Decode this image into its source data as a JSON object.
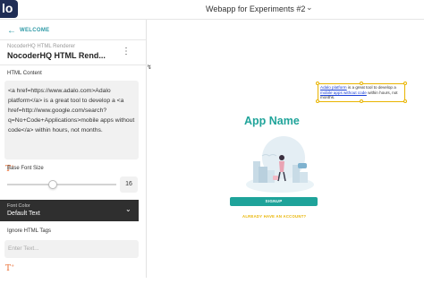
{
  "app": {
    "logo_text": "lo",
    "name": "Webapp for Experiments #2"
  },
  "panel": {
    "back_label": "WELCOME",
    "component_type": "NocoderHQ HTML Renderer",
    "component_name": "NocoderHQ HTML Rend...",
    "html_content_label": "HTML Content",
    "html_content_value": "<a href=https://www.adalo.com>Adalo platform</a> is a great tool to develop a <a href=http://www.google.com/search?q=No+Code+Applications>mobile apps without code</a> within hours, not months.",
    "base_font_size_label": "Base Font Size",
    "base_font_size_value": "16",
    "base_font_size_level": 0.42,
    "font_color_label": "Font Color",
    "font_color_value": "Default Text",
    "ignore_tags_label": "Ignore HTML Tags",
    "ignore_tags_placeholder": "Enter Text..."
  },
  "preview": {
    "link1": "Adalo platform",
    "text1": " is a great tool to develop a ",
    "link2": "mobile apps without code",
    "text2": " within hours, not months.",
    "title": "App Name",
    "signup_label": "SIGNUP",
    "login_label": "ALREADY HAVE AN ACCOUNT?"
  },
  "colors": {
    "accent": "#2e99a6",
    "brand_dark": "#1f2d55",
    "selection": "#e9b400",
    "title": "#20a49a",
    "button": "#1ea39a",
    "magic_text_icon": "#e9682b"
  }
}
